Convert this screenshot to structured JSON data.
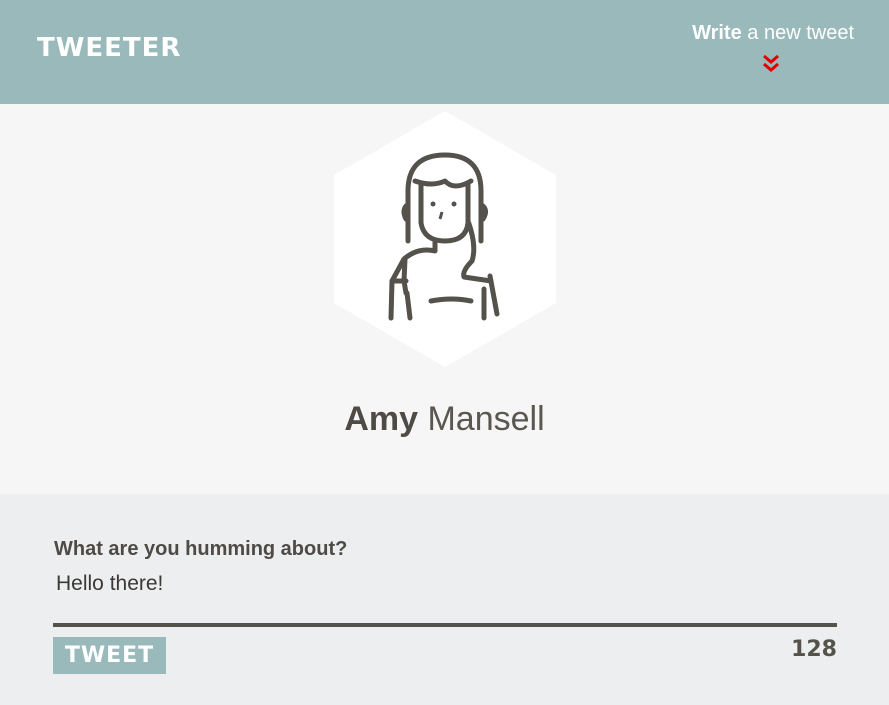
{
  "header": {
    "logo": "TWEETER",
    "write_link_bold": "Write",
    "write_link_rest": "a new tweet",
    "chevron_icon": "double-chevron-down-icon"
  },
  "profile": {
    "avatar_icon": "woman-avatar-icon",
    "first_name": "Amy",
    "last_name": "Mansell"
  },
  "compose": {
    "prompt": "What are you humming about?",
    "input_value": "Hello there!",
    "button_label": "TWEET",
    "char_count": "128"
  },
  "colors": {
    "header_bg": "#99b9ba",
    "accent_red": "#e00000",
    "text_dark": "#4e4a45",
    "compose_bg": "#edeef0",
    "profile_bg": "#f6f6f6"
  }
}
